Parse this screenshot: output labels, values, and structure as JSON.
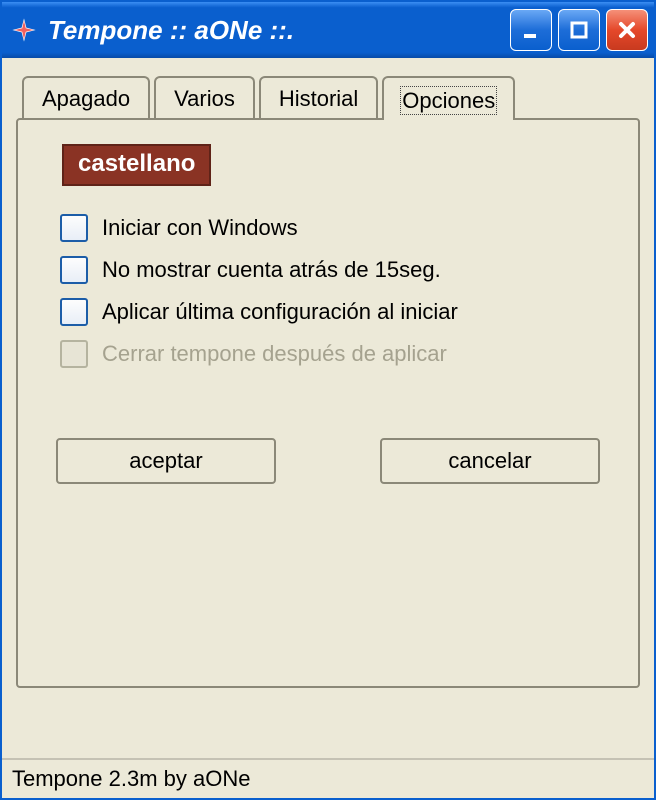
{
  "window": {
    "title": "Tempone :: aONe ::."
  },
  "tabs": [
    {
      "label": "Apagado",
      "active": false
    },
    {
      "label": "Varios",
      "active": false
    },
    {
      "label": "Historial",
      "active": false
    },
    {
      "label": "Opciones",
      "active": true
    }
  ],
  "options": {
    "language_badge": "castellano",
    "checks": [
      {
        "label": "Iniciar con Windows",
        "checked": false,
        "enabled": true
      },
      {
        "label": "No mostrar cuenta atrás de 15seg.",
        "checked": false,
        "enabled": true
      },
      {
        "label": "Aplicar última configuración al iniciar",
        "checked": false,
        "enabled": true
      },
      {
        "label": "Cerrar tempone después de aplicar",
        "checked": false,
        "enabled": false
      }
    ]
  },
  "buttons": {
    "accept": "aceptar",
    "cancel": "cancelar"
  },
  "statusbar": "Tempone 2.3m by aONe"
}
